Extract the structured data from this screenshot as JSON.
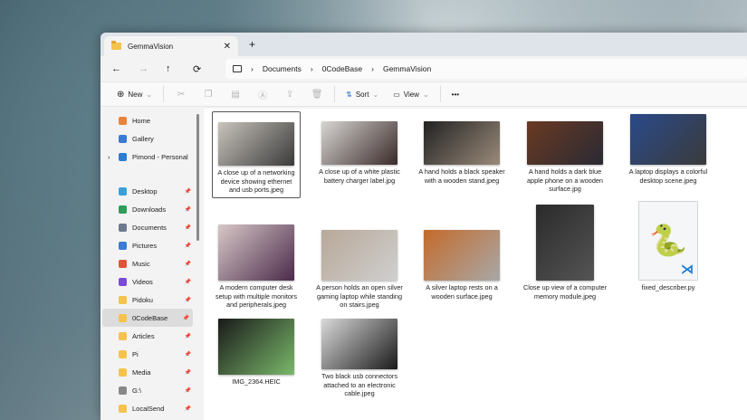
{
  "tab": {
    "title": "GemmaVision",
    "close": "✕",
    "new": "+"
  },
  "nav": {
    "back": "←",
    "forward": "→",
    "up": "↑",
    "refresh": "⟳"
  },
  "breadcrumb": [
    "Documents",
    "0CodeBase",
    "GemmaVision"
  ],
  "toolbar": {
    "new": "New",
    "sort": "Sort",
    "view": "View",
    "more": "•••"
  },
  "sidebar": [
    {
      "label": "Home",
      "color": "#e8843a",
      "pin": false
    },
    {
      "label": "Gallery",
      "color": "#3a7bd5",
      "pin": false
    },
    {
      "label": "Pimond - Personal",
      "color": "#2b7cd3",
      "pin": false,
      "expand": true
    },
    {
      "label": "Desktop",
      "color": "#3aa0d8",
      "pin": true
    },
    {
      "label": "Downloads",
      "color": "#2e9d5a",
      "pin": true
    },
    {
      "label": "Documents",
      "color": "#6b7a8c",
      "pin": true
    },
    {
      "label": "Pictures",
      "color": "#3a7bd5",
      "pin": true
    },
    {
      "label": "Music",
      "color": "#e0533a",
      "pin": true
    },
    {
      "label": "Videos",
      "color": "#7a4ad8",
      "pin": true
    },
    {
      "label": "Pidoku",
      "color": "#f4c24d",
      "pin": true
    },
    {
      "label": "0CodeBase",
      "color": "#f4c24d",
      "pin": true,
      "selected": true
    },
    {
      "label": "Articles",
      "color": "#f4c24d",
      "pin": true
    },
    {
      "label": "Pi",
      "color": "#f4c24d",
      "pin": true
    },
    {
      "label": "Media",
      "color": "#f4c24d",
      "pin": true
    },
    {
      "label": "G:\\",
      "color": "#888888",
      "pin": true
    },
    {
      "label": "LocalSend",
      "color": "#f4c24d",
      "pin": true
    }
  ],
  "files": [
    {
      "name": "A close up of a networking device showing ethernet and usb ports.jpeg",
      "colors": [
        "#c9c4bc",
        "#3a3a3a"
      ],
      "selected": true
    },
    {
      "name": "A close up of a white plastic battery charger label.jpg",
      "colors": [
        "#d8d6d2",
        "#3a2a2a"
      ]
    },
    {
      "name": "A hand holds a black speaker with a wooden stand.jpeg",
      "colors": [
        "#222222",
        "#9a8a7a"
      ]
    },
    {
      "name": "A hand holds a dark blue apple phone on a wooden surface.jpg",
      "colors": [
        "#6a3a22",
        "#2a2a35"
      ]
    },
    {
      "name": "A laptop displays a colorful desktop scene.jpeg",
      "colors": [
        "#2a4a8a",
        "#3a3a3a"
      ]
    },
    {
      "name": "A modern computer desk setup with multiple monitors and peripherals.jpeg",
      "colors": [
        "#d8c8c8",
        "#4a2a4a"
      ]
    },
    {
      "name": "A person holds an open silver gaming laptop while standing on stairs.jpeg",
      "colors": [
        "#b8a898",
        "#cfcfcf"
      ]
    },
    {
      "name": "A silver laptop rests on a wooden surface.jpeg",
      "colors": [
        "#c46a2a",
        "#a8a8a8"
      ]
    },
    {
      "name": "Close up view of a computer memory module.jpeg",
      "colors": [
        "#2a2a2a",
        "#555555"
      ]
    },
    {
      "name": "fixed_describer.py",
      "python": true
    },
    {
      "name": "IMG_2364.HEIC",
      "colors": [
        "#1a1a1a",
        "#7ab86a"
      ]
    },
    {
      "name": "Two black usb connectors attached to an electronic cable.jpeg",
      "colors": [
        "#dadada",
        "#1a1a1a"
      ]
    }
  ]
}
